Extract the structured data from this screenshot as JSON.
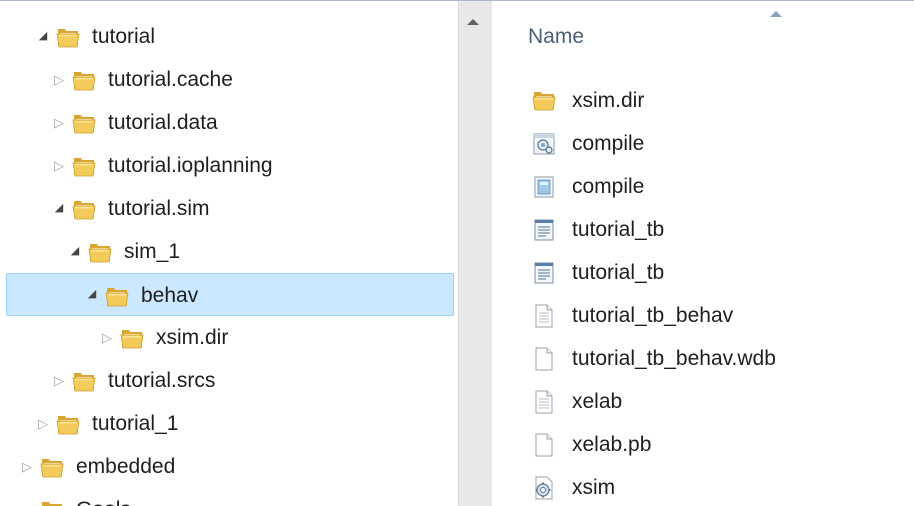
{
  "tree": [
    {
      "label": "tutorial",
      "state": "expanded",
      "level": 2
    },
    {
      "label": "tutorial.cache",
      "state": "collapsed",
      "level": 3
    },
    {
      "label": "tutorial.data",
      "state": "collapsed",
      "level": 3
    },
    {
      "label": "tutorial.ioplanning",
      "state": "collapsed",
      "level": 3
    },
    {
      "label": "tutorial.sim",
      "state": "expanded",
      "level": 3
    },
    {
      "label": "sim_1",
      "state": "expanded",
      "level": 4
    },
    {
      "label": "behav",
      "state": "expanded",
      "level": 5,
      "selected": true
    },
    {
      "label": "xsim.dir",
      "state": "collapsed",
      "level": 6
    },
    {
      "label": "tutorial.srcs",
      "state": "collapsed",
      "level": 3
    },
    {
      "label": "tutorial_1",
      "state": "collapsed",
      "level": 2
    },
    {
      "label": "embedded",
      "state": "collapsed",
      "level": 1
    },
    {
      "label": "Gools",
      "state": "collapsed",
      "level": 1
    }
  ],
  "list": {
    "column_name": "Name",
    "files": [
      {
        "name": "xsim.dir",
        "icon": "folder-icon"
      },
      {
        "name": "compile",
        "icon": "batch-file-icon"
      },
      {
        "name": "compile",
        "icon": "script-file-icon"
      },
      {
        "name": "tutorial_tb",
        "icon": "log-file-icon"
      },
      {
        "name": "tutorial_tb",
        "icon": "log-file-icon"
      },
      {
        "name": "tutorial_tb_behav",
        "icon": "text-file-icon"
      },
      {
        "name": "tutorial_tb_behav.wdb",
        "icon": "blank-file-icon"
      },
      {
        "name": "xelab",
        "icon": "text-file-icon"
      },
      {
        "name": "xelab.pb",
        "icon": "blank-file-icon"
      },
      {
        "name": "xsim",
        "icon": "settings-file-icon"
      }
    ]
  },
  "colors": {
    "selection_fill": "#cce8ff",
    "selection_border": "#99d1ff",
    "column_header_text": "#4c607a"
  }
}
